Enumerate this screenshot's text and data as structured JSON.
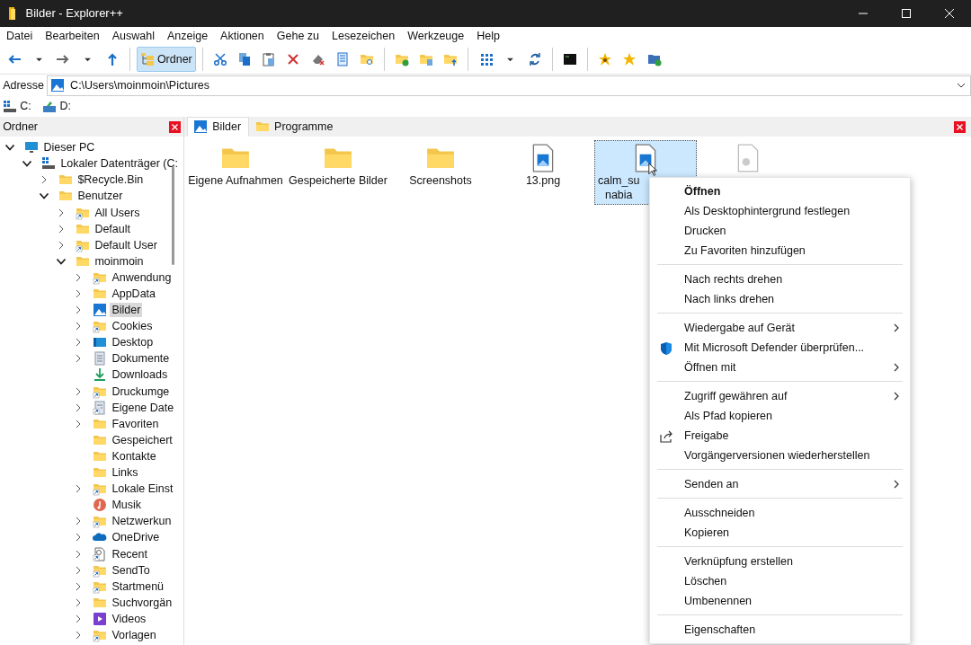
{
  "window": {
    "title": "Bilder - Explorer++"
  },
  "menu": [
    "Datei",
    "Bearbeiten",
    "Auswahl",
    "Anzeige",
    "Aktionen",
    "Gehe zu",
    "Lesezeichen",
    "Werkzeuge",
    "Help"
  ],
  "toolbar": [
    {
      "kind": "back"
    },
    {
      "kind": "dropdown"
    },
    {
      "kind": "forward"
    },
    {
      "kind": "dropdown"
    },
    {
      "kind": "up"
    },
    {
      "kind": "separator"
    },
    {
      "kind": "folders",
      "label": "Ordner",
      "pressed": true
    },
    {
      "kind": "separator"
    },
    {
      "kind": "cut"
    },
    {
      "kind": "copy"
    },
    {
      "kind": "paste"
    },
    {
      "kind": "delete"
    },
    {
      "kind": "erase"
    },
    {
      "kind": "properties"
    },
    {
      "kind": "search"
    },
    {
      "kind": "separator"
    },
    {
      "kind": "newfolder"
    },
    {
      "kind": "copyto"
    },
    {
      "kind": "moveto"
    },
    {
      "kind": "separator"
    },
    {
      "kind": "views"
    },
    {
      "kind": "dropdown"
    },
    {
      "kind": "refresh"
    },
    {
      "kind": "separator"
    },
    {
      "kind": "terminal"
    },
    {
      "kind": "separator"
    },
    {
      "kind": "addbookmark"
    },
    {
      "kind": "bookmarks"
    },
    {
      "kind": "newtab"
    }
  ],
  "address": {
    "label": "Adresse",
    "value": "C:\\Users\\moinmoin\\Pictures"
  },
  "drives": [
    {
      "label": "C:",
      "kind": "drive"
    },
    {
      "label": "D:",
      "kind": "dvd"
    }
  ],
  "folders_pane": {
    "title": "Ordner",
    "tree": [
      {
        "label": "Dieser PC",
        "kind": "pc",
        "expandable": true,
        "expanded": true,
        "selected": false,
        "children": [
          {
            "label": "Lokaler Datenträger (C:",
            "kind": "drive",
            "expandable": true,
            "expanded": true,
            "selected": false,
            "children": [
              {
                "label": "$Recycle.Bin",
                "kind": "folder",
                "expandable": true,
                "expanded": false,
                "selected": false
              },
              {
                "label": "Benutzer",
                "kind": "folder",
                "expandable": true,
                "expanded": true,
                "selected": false,
                "children": [
                  {
                    "label": "All Users",
                    "kind": "shortcut",
                    "expandable": true,
                    "expanded": false,
                    "selected": false
                  },
                  {
                    "label": "Default",
                    "kind": "folder",
                    "expandable": true,
                    "expanded": false,
                    "selected": false
                  },
                  {
                    "label": "Default User",
                    "kind": "shortcut",
                    "expandable": true,
                    "expanded": false,
                    "selected": false
                  },
                  {
                    "label": "moinmoin",
                    "kind": "folder",
                    "expandable": true,
                    "expanded": true,
                    "selected": false,
                    "children": [
                      {
                        "label": "Anwendung",
                        "kind": "shortcut",
                        "expandable": true,
                        "expanded": false,
                        "selected": false
                      },
                      {
                        "label": "AppData",
                        "kind": "folder",
                        "expandable": true,
                        "expanded": false,
                        "selected": false
                      },
                      {
                        "label": "Bilder",
                        "kind": "pictures",
                        "expandable": true,
                        "expanded": false,
                        "selected": true
                      },
                      {
                        "label": "Cookies",
                        "kind": "shortcut",
                        "expandable": true,
                        "expanded": false,
                        "selected": false
                      },
                      {
                        "label": "Desktop",
                        "kind": "desktop",
                        "expandable": true,
                        "expanded": false,
                        "selected": false
                      },
                      {
                        "label": "Dokumente",
                        "kind": "documents",
                        "expandable": true,
                        "expanded": false,
                        "selected": false
                      },
                      {
                        "label": "Downloads",
                        "kind": "downloads",
                        "expandable": false,
                        "selected": false
                      },
                      {
                        "label": "Druckumge",
                        "kind": "shortcut",
                        "expandable": true,
                        "expanded": false,
                        "selected": false
                      },
                      {
                        "label": "Eigene Date",
                        "kind": "docshortcut",
                        "expandable": true,
                        "expanded": false,
                        "selected": false
                      },
                      {
                        "label": "Favoriten",
                        "kind": "folder",
                        "expandable": true,
                        "expanded": false,
                        "selected": false
                      },
                      {
                        "label": "Gespeichert",
                        "kind": "folder",
                        "expandable": false,
                        "selected": false
                      },
                      {
                        "label": "Kontakte",
                        "kind": "folder",
                        "expandable": false,
                        "selected": false
                      },
                      {
                        "label": "Links",
                        "kind": "folder",
                        "expandable": false,
                        "selected": false
                      },
                      {
                        "label": "Lokale Einst",
                        "kind": "shortcut",
                        "expandable": true,
                        "expanded": false,
                        "selected": false
                      },
                      {
                        "label": "Musik",
                        "kind": "music",
                        "expandable": false,
                        "selected": false
                      },
                      {
                        "label": "Netzwerkun",
                        "kind": "shortcut",
                        "expandable": true,
                        "expanded": false,
                        "selected": false
                      },
                      {
                        "label": "OneDrive",
                        "kind": "onedrive",
                        "expandable": true,
                        "expanded": false,
                        "selected": false
                      },
                      {
                        "label": "Recent",
                        "kind": "recent",
                        "expandable": true,
                        "expanded": false,
                        "selected": false
                      },
                      {
                        "label": "SendTo",
                        "kind": "shortcut",
                        "expandable": true,
                        "expanded": false,
                        "selected": false
                      },
                      {
                        "label": "Startmenü",
                        "kind": "shortcut",
                        "expandable": true,
                        "expanded": false,
                        "selected": false
                      },
                      {
                        "label": "Suchvorgän",
                        "kind": "folder",
                        "expandable": true,
                        "expanded": false,
                        "selected": false
                      },
                      {
                        "label": "Videos",
                        "kind": "videos",
                        "expandable": true,
                        "expanded": false,
                        "selected": false
                      },
                      {
                        "label": "Vorlagen",
                        "kind": "shortcut",
                        "expandable": true,
                        "expanded": false,
                        "selected": false
                      }
                    ]
                  }
                ]
              }
            ]
          }
        ]
      }
    ]
  },
  "tabs": [
    {
      "label": "Bilder",
      "kind": "pictures",
      "selected": true
    },
    {
      "label": "Programme",
      "kind": "folder",
      "selected": false
    }
  ],
  "files": [
    {
      "lines": [
        "Eigene Aufnahmen"
      ],
      "kind": "folder",
      "selected": false
    },
    {
      "lines": [
        "Gespeicherte Bilder"
      ],
      "kind": "folder",
      "selected": false
    },
    {
      "lines": [
        "Screenshots"
      ],
      "kind": "folder",
      "selected": false
    },
    {
      "lines": [
        "13.png"
      ],
      "kind": "image",
      "selected": false
    },
    {
      "lines": [
        "calm_su",
        "nabia"
      ],
      "kind": "image",
      "selected": true
    },
    {
      "kind": "settings",
      "selected": false
    }
  ],
  "context_menu": [
    {
      "kind": "item",
      "label": "Öffnen",
      "default": true,
      "submenu": false
    },
    {
      "kind": "item",
      "label": "Als Desktophintergrund festlegen",
      "default": false,
      "submenu": false
    },
    {
      "kind": "item",
      "label": "Drucken",
      "default": false,
      "submenu": false
    },
    {
      "kind": "item",
      "label": "Zu Favoriten hinzufügen",
      "default": false,
      "submenu": false
    },
    {
      "kind": "separator"
    },
    {
      "kind": "item",
      "label": "Nach rechts drehen",
      "default": false,
      "submenu": false
    },
    {
      "kind": "item",
      "label": "Nach links drehen",
      "default": false,
      "submenu": false
    },
    {
      "kind": "separator"
    },
    {
      "kind": "item",
      "label": "Wiedergabe auf Gerät",
      "default": false,
      "submenu": true
    },
    {
      "kind": "scan",
      "label": "Mit Microsoft Defender überprüfen...",
      "default": false,
      "submenu": false
    },
    {
      "kind": "item",
      "label": "Öffnen mit",
      "default": false,
      "submenu": true
    },
    {
      "kind": "separator"
    },
    {
      "kind": "item",
      "label": "Zugriff gewähren auf",
      "default": false,
      "submenu": true
    },
    {
      "kind": "item",
      "label": "Als Pfad kopieren",
      "default": false,
      "submenu": false
    },
    {
      "kind": "share",
      "label": "Freigabe",
      "default": false,
      "submenu": false
    },
    {
      "kind": "item",
      "label": "Vorgängerversionen wiederherstellen",
      "default": false,
      "submenu": false
    },
    {
      "kind": "separator"
    },
    {
      "kind": "item",
      "label": "Senden an",
      "default": false,
      "submenu": true
    },
    {
      "kind": "separator"
    },
    {
      "kind": "item",
      "label": "Ausschneiden",
      "default": false,
      "submenu": false
    },
    {
      "kind": "item",
      "label": "Kopieren",
      "default": false,
      "submenu": false
    },
    {
      "kind": "separator"
    },
    {
      "kind": "item",
      "label": "Verknüpfung erstellen",
      "default": false,
      "submenu": false
    },
    {
      "kind": "item",
      "label": "Löschen",
      "default": false,
      "submenu": false
    },
    {
      "kind": "item",
      "label": "Umbenennen",
      "default": false,
      "submenu": false
    },
    {
      "kind": "separator"
    },
    {
      "kind": "item",
      "label": "Eigenschaften",
      "default": false,
      "submenu": false
    }
  ]
}
